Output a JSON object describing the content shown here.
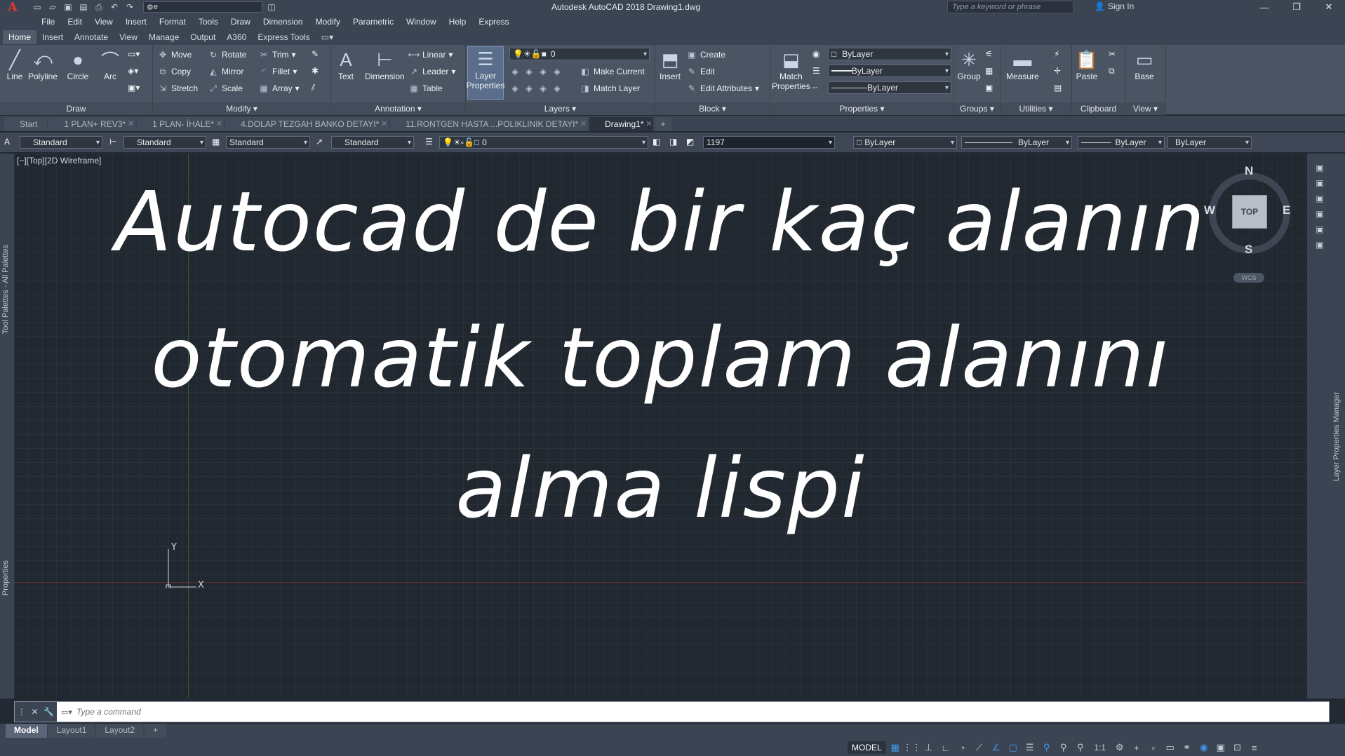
{
  "window": {
    "title": "Autodesk AutoCAD 2018    Drawing1.dwg",
    "logo": "A",
    "workspace": "e",
    "search_placeholder": "Type a keyword or phrase",
    "sign_in": "Sign In"
  },
  "menu": [
    "File",
    "Edit",
    "View",
    "Insert",
    "Format",
    "Tools",
    "Draw",
    "Dimension",
    "Modify",
    "Parametric",
    "Window",
    "Help",
    "Express"
  ],
  "ribbon_tabs": [
    "Home",
    "Insert",
    "Annotate",
    "View",
    "Manage",
    "Output",
    "A360",
    "Express Tools"
  ],
  "ribbon": {
    "draw": {
      "title": "Draw",
      "line": "Line",
      "polyline": "Polyline",
      "circle": "Circle",
      "arc": "Arc"
    },
    "modify": {
      "title": "Modify",
      "move": "Move",
      "rotate": "Rotate",
      "trim": "Trim",
      "copy": "Copy",
      "mirror": "Mirror",
      "fillet": "Fillet",
      "stretch": "Stretch",
      "scale": "Scale",
      "array": "Array"
    },
    "annotation": {
      "title": "Annotation",
      "text": "Text",
      "dimension": "Dimension",
      "linear": "Linear",
      "leader": "Leader",
      "table": "Table"
    },
    "layers": {
      "title": "Layers",
      "layer_properties_1": "Layer",
      "layer_properties_2": "Properties",
      "current_layer": "0",
      "make_current": "Make Current",
      "match_layer": "Match Layer"
    },
    "block": {
      "title": "Block",
      "insert": "Insert",
      "create": "Create",
      "edit": "Edit",
      "edit_attributes": "Edit Attributes"
    },
    "properties": {
      "title": "Properties",
      "match_1": "Match",
      "match_2": "Properties",
      "color": "ByLayer",
      "lineweight": "ByLayer",
      "linetype": "ByLayer"
    },
    "groups": {
      "title": "Groups",
      "group": "Group"
    },
    "utilities": {
      "title": "Utilities",
      "measure": "Measure"
    },
    "clipboard": {
      "title": "Clipboard",
      "paste": "Paste"
    },
    "view": {
      "title": "View",
      "base": "Base"
    }
  },
  "file_tabs": [
    {
      "label": "Start"
    },
    {
      "label": "1 PLAN+ REV3*"
    },
    {
      "label": "1 PLAN- İHALE*"
    },
    {
      "label": "4.DOLAP TEZGAH BANKO DETAYI*"
    },
    {
      "label": "11.RONTGEN HASTA ...POLIKLINIK DETAYI*"
    },
    {
      "label": "Drawing1*"
    }
  ],
  "style_toolbar": {
    "text_style": "Standard",
    "dim_style": "Standard",
    "table_style": "Standard",
    "mleader_style": "Standard",
    "layer": "0",
    "coord": "1197",
    "color": "ByLayer",
    "linetype": "ByLayer",
    "lineweight": "ByLayer",
    "plotstyle": "ByLayer"
  },
  "viewport": {
    "label": "[−][Top][2D Wireframe]",
    "overlay_lines": [
      "Autocad de bir kaç alanın",
      "otomatik toplam alanını",
      "alma lispi"
    ],
    "ucs_x": "X",
    "ucs_y": "Y"
  },
  "viewcube": {
    "top": "TOP",
    "north": "N",
    "south": "S",
    "east": "E",
    "west": "W",
    "wcs": "WCS"
  },
  "palettes": {
    "tool_palettes": "Tool Palettes - All Palettes",
    "properties": "Properties",
    "layer_manager": "Layer Properties Manager"
  },
  "command": {
    "placeholder": "Type a command"
  },
  "layout_tabs": [
    "Model",
    "Layout1",
    "Layout2",
    "+"
  ],
  "status": {
    "model": "MODEL",
    "scale": "1:1"
  }
}
